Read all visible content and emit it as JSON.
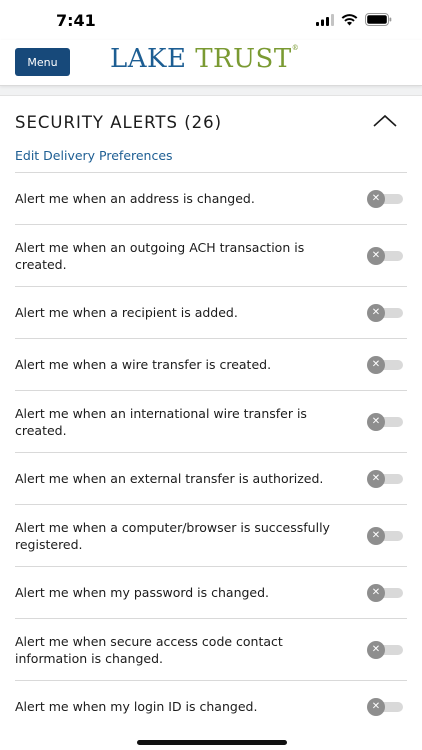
{
  "status_bar": {
    "time": "7:41"
  },
  "header": {
    "menu_label": "Menu",
    "logo_lake": "LAKE",
    "logo_trust": "TRUST",
    "logo_mark": "®"
  },
  "section": {
    "title": "SECURITY ALERTS (26)",
    "edit_link": "Edit Delivery Preferences"
  },
  "alerts": [
    {
      "label": "Alert me when an address is changed.",
      "enabled": false
    },
    {
      "label": "Alert me when an outgoing ACH transaction is created.",
      "enabled": false
    },
    {
      "label": "Alert me when a recipient is added.",
      "enabled": false
    },
    {
      "label": "Alert me when a wire transfer is created.",
      "enabled": false
    },
    {
      "label": "Alert me when an international wire transfer is created.",
      "enabled": false
    },
    {
      "label": "Alert me when an external transfer is authorized.",
      "enabled": false
    },
    {
      "label": "Alert me when a computer/browser is successfully registered.",
      "enabled": false
    },
    {
      "label": "Alert me when my password is changed.",
      "enabled": false
    },
    {
      "label": "Alert me when secure access code contact information is changed.",
      "enabled": false
    },
    {
      "label": "Alert me when my login ID is changed.",
      "enabled": false
    }
  ],
  "toggle_off_glyph": "✕",
  "colors": {
    "brand_blue": "#17497a",
    "brand_green": "#7a9a32",
    "link": "#1d5e93",
    "toggle_off": "#8e8e8e"
  }
}
